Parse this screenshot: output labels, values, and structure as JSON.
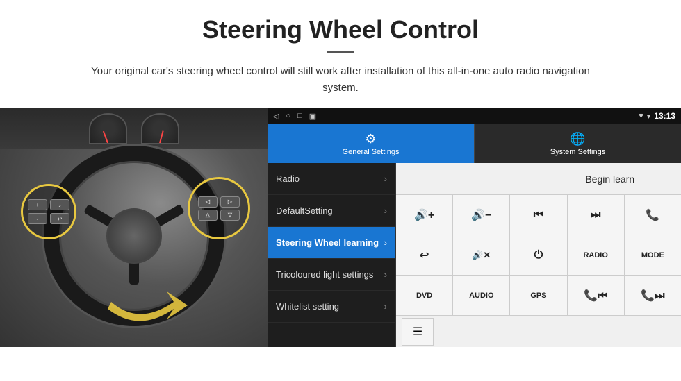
{
  "header": {
    "title": "Steering Wheel Control",
    "description": "Your original car's steering wheel control will still work after installation of this all-in-one auto radio navigation system."
  },
  "status_bar": {
    "icons": [
      "◁",
      "○",
      "□",
      "▣"
    ],
    "right_icons": [
      "♥",
      "▾"
    ],
    "time": "13:13"
  },
  "tabs": {
    "general": {
      "label": "General Settings",
      "icon": "⚙"
    },
    "system": {
      "label": "System Settings",
      "icon": "🌐"
    }
  },
  "menu": {
    "items": [
      {
        "label": "Radio",
        "active": false
      },
      {
        "label": "DefaultSetting",
        "active": false
      },
      {
        "label": "Steering Wheel learning",
        "active": true
      },
      {
        "label": "Tricoloured light settings",
        "active": false
      },
      {
        "label": "Whitelist setting",
        "active": false
      }
    ]
  },
  "controls": {
    "begin_learn_label": "Begin learn",
    "buttons_row1": [
      {
        "label": "🔊+",
        "type": "icon"
      },
      {
        "label": "🔊-",
        "type": "icon"
      },
      {
        "label": "⏮",
        "type": "icon"
      },
      {
        "label": "⏭",
        "type": "icon"
      },
      {
        "label": "📞",
        "type": "icon"
      }
    ],
    "buttons_row2": [
      {
        "label": "↩",
        "type": "icon"
      },
      {
        "label": "🔊✕",
        "type": "icon"
      },
      {
        "label": "⏻",
        "type": "icon"
      },
      {
        "label": "RADIO",
        "type": "text"
      },
      {
        "label": "MODE",
        "type": "text"
      }
    ],
    "buttons_row3": [
      {
        "label": "DVD",
        "type": "text"
      },
      {
        "label": "AUDIO",
        "type": "text"
      },
      {
        "label": "GPS",
        "type": "text"
      },
      {
        "label": "📞⏮",
        "type": "icon"
      },
      {
        "label": "📞⏭",
        "type": "icon"
      }
    ],
    "list_icon": "☰"
  }
}
